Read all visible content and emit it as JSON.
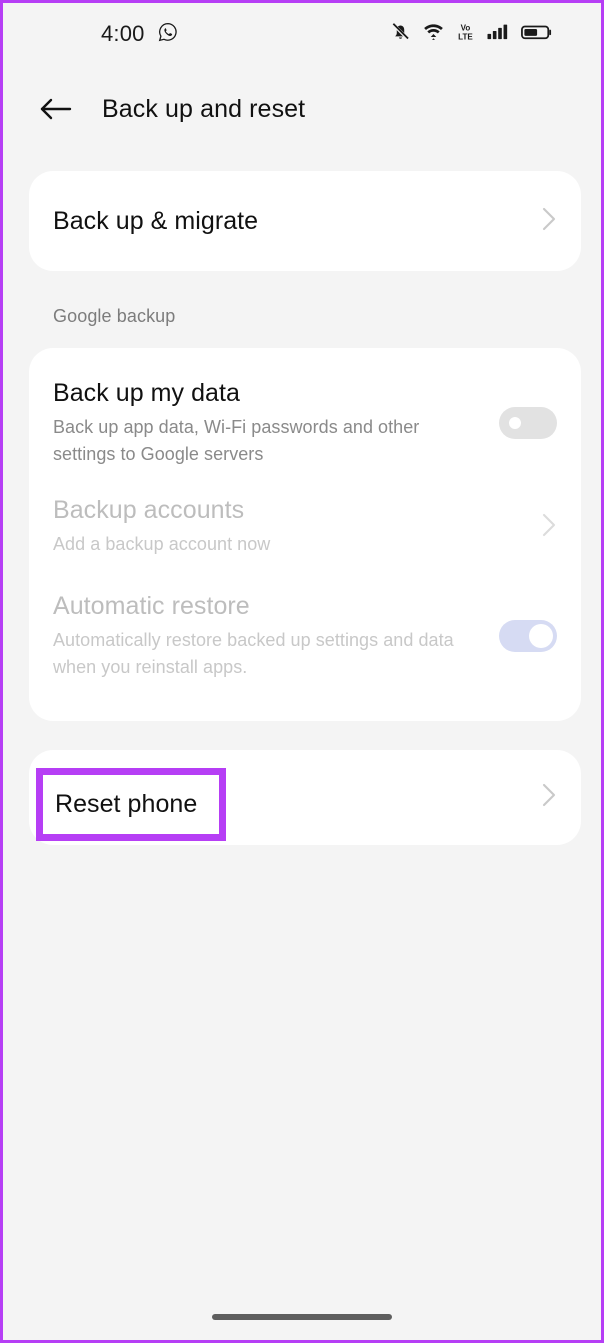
{
  "theme": {
    "background": "#f4f4f4",
    "card_background": "#ffffff",
    "accent_highlight": "#b63ef5",
    "toggle_off": "#e2e2e2",
    "toggle_on_disabled": "#d6dbf3",
    "title_color": "#111111",
    "subtitle_color": "#8a8a8a",
    "disabled_color": "#bdbdbd"
  },
  "status_bar": {
    "time": "4:00",
    "notification_icon": "whatsapp-icon",
    "icons": [
      "bell-muted-icon",
      "wifi-icon",
      "volte-icon",
      "signal-bars-icon",
      "battery-icon"
    ],
    "volte_top": "Vo",
    "volte_bottom": "LTE"
  },
  "app_bar": {
    "back_icon": "back-arrow-icon",
    "title": "Back up and reset"
  },
  "cards": {
    "migrate": {
      "title": "Back up & migrate",
      "chevron": "chevron-right-icon"
    },
    "google_backup": {
      "section_label": "Google backup",
      "rows": [
        {
          "title": "Back up my data",
          "subtitle": "Back up app data, Wi-Fi passwords and other settings to Google servers",
          "control": "toggle",
          "toggle_state": "off",
          "enabled": true
        },
        {
          "title": "Backup accounts",
          "subtitle": "Add a backup account now",
          "control": "chevron",
          "chevron": "chevron-right-icon",
          "enabled": false
        },
        {
          "title": "Automatic restore",
          "subtitle": "Automatically restore backed up settings and data when you reinstall apps.",
          "control": "toggle",
          "toggle_state": "on",
          "enabled": false
        }
      ]
    },
    "reset": {
      "title": "Reset phone",
      "chevron": "chevron-right-icon",
      "highlighted": true
    }
  },
  "navigation": {
    "gesture_bar": "home-gesture-bar"
  }
}
